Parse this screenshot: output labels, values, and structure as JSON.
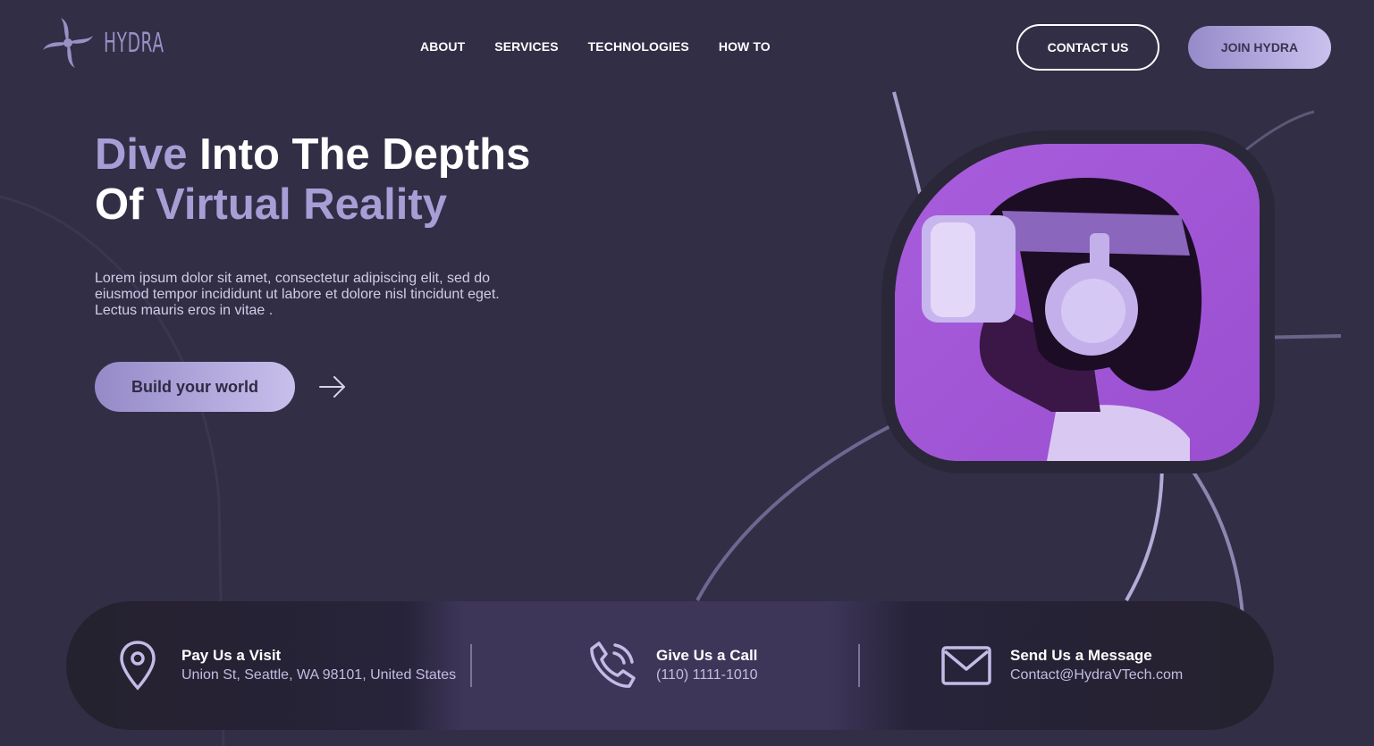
{
  "brand": {
    "name": "HYDRA"
  },
  "nav": {
    "items": [
      "ABOUT",
      "SERVICES",
      "TECHNOLOGIES",
      "HOW TO"
    ]
  },
  "header": {
    "contact_label": "CONTACT US",
    "join_label": "JOIN HYDRA"
  },
  "hero": {
    "title_line1_accent": "Dive",
    "title_line1_rest": " Into The Depths",
    "title_line2_start": "Of ",
    "title_line2_accent": "Virtual Reality",
    "description": "Lorem ipsum dolor sit amet, consectetur adipiscing elit, sed do eiusmod tempor incididunt ut labore et dolore nisl tincidunt eget. Lectus mauris eros in vitae .",
    "cta_label": "Build your world"
  },
  "contact": {
    "visit": {
      "title": "Pay Us a Visit",
      "value": "Union St, Seattle, WA 98101, United States",
      "icon": "location-pin-icon"
    },
    "call": {
      "title": "Give Us a Call",
      "value": "(110) 1111-1010",
      "icon": "phone-icon"
    },
    "message": {
      "title": "Send Us a Message",
      "value": "Contact@HydraVTech.com",
      "icon": "mail-icon"
    }
  },
  "colors": {
    "background": "#322e45",
    "accent": "#a89ed6",
    "photo_bg": "#a45ad8"
  }
}
